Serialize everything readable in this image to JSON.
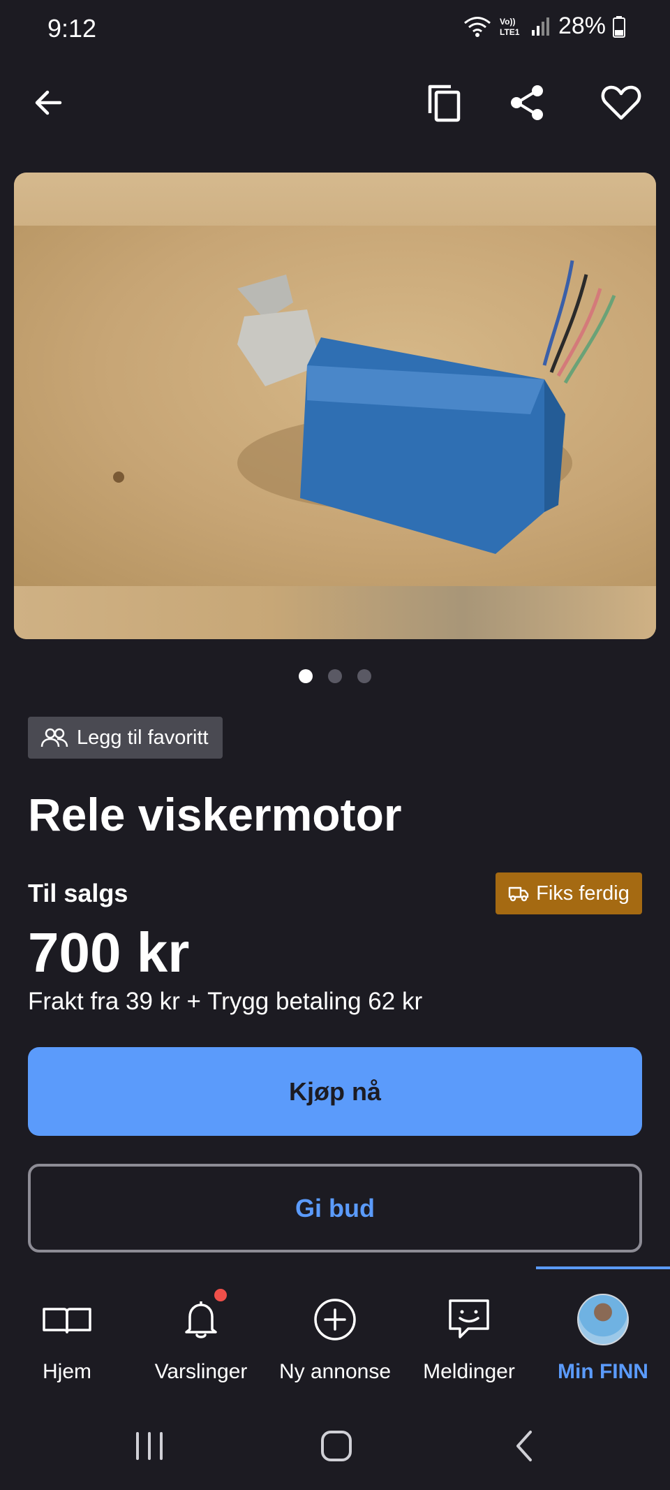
{
  "status_bar": {
    "time": "9:12",
    "battery": "28%",
    "network_label": "Vo)) LTE1"
  },
  "toolbar": {
    "back_icon": "arrow-left-icon",
    "copy_icon": "copy-icon",
    "share_icon": "share-icon",
    "favorite_icon": "heart-icon"
  },
  "gallery": {
    "image_count": 3,
    "active_index": 0
  },
  "listing": {
    "favorite_chip_label": "Legg til favoritt",
    "title": "Rele viskermotor",
    "sale_type": "Til salgs",
    "shipping_badge": "Fiks ferdig",
    "price": "700 kr",
    "shipping_info": "Frakt fra 39 kr + Trygg betaling 62 kr",
    "buy_button": "Kjøp nå",
    "bid_button": "Gi bud"
  },
  "bottom_nav": {
    "items": [
      {
        "label": "Hjem",
        "icon": "book-icon"
      },
      {
        "label": "Varslinger",
        "icon": "bell-icon"
      },
      {
        "label": "Ny annonse",
        "icon": "plus-circle-icon"
      },
      {
        "label": "Meldinger",
        "icon": "chat-icon"
      },
      {
        "label": "Min FINN",
        "icon": "avatar"
      }
    ],
    "active_item": "Min FINN"
  },
  "colors": {
    "background": "#1c1b22",
    "accent": "#5b9bfb",
    "badge": "#a56a12",
    "chip": "#4a4a52",
    "notification": "#f0504a"
  }
}
